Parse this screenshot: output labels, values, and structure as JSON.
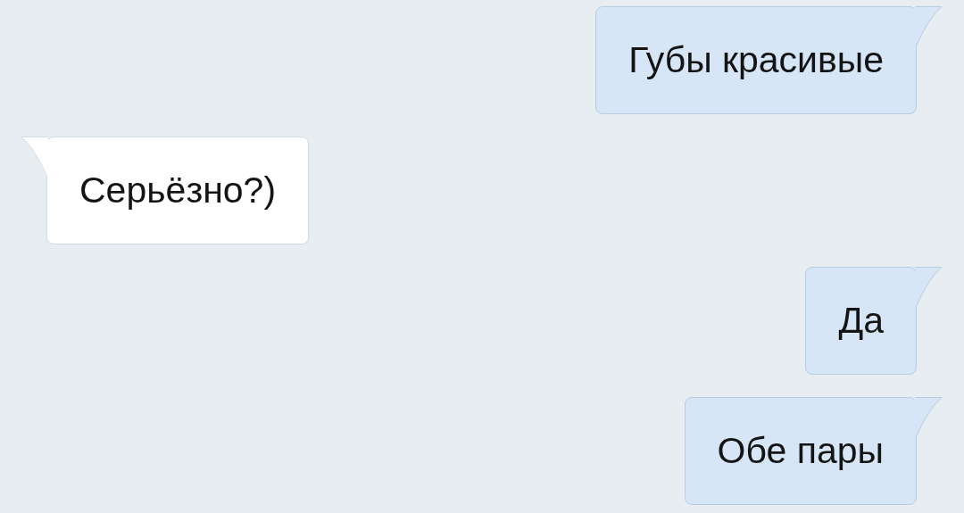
{
  "messages": [
    {
      "kind": "outgoing",
      "text": "Губы красивые"
    },
    {
      "kind": "incoming",
      "text": "Серьёзно?)"
    },
    {
      "kind": "outgoing",
      "text": "Да"
    },
    {
      "kind": "outgoing",
      "text": "Обе пары"
    }
  ]
}
